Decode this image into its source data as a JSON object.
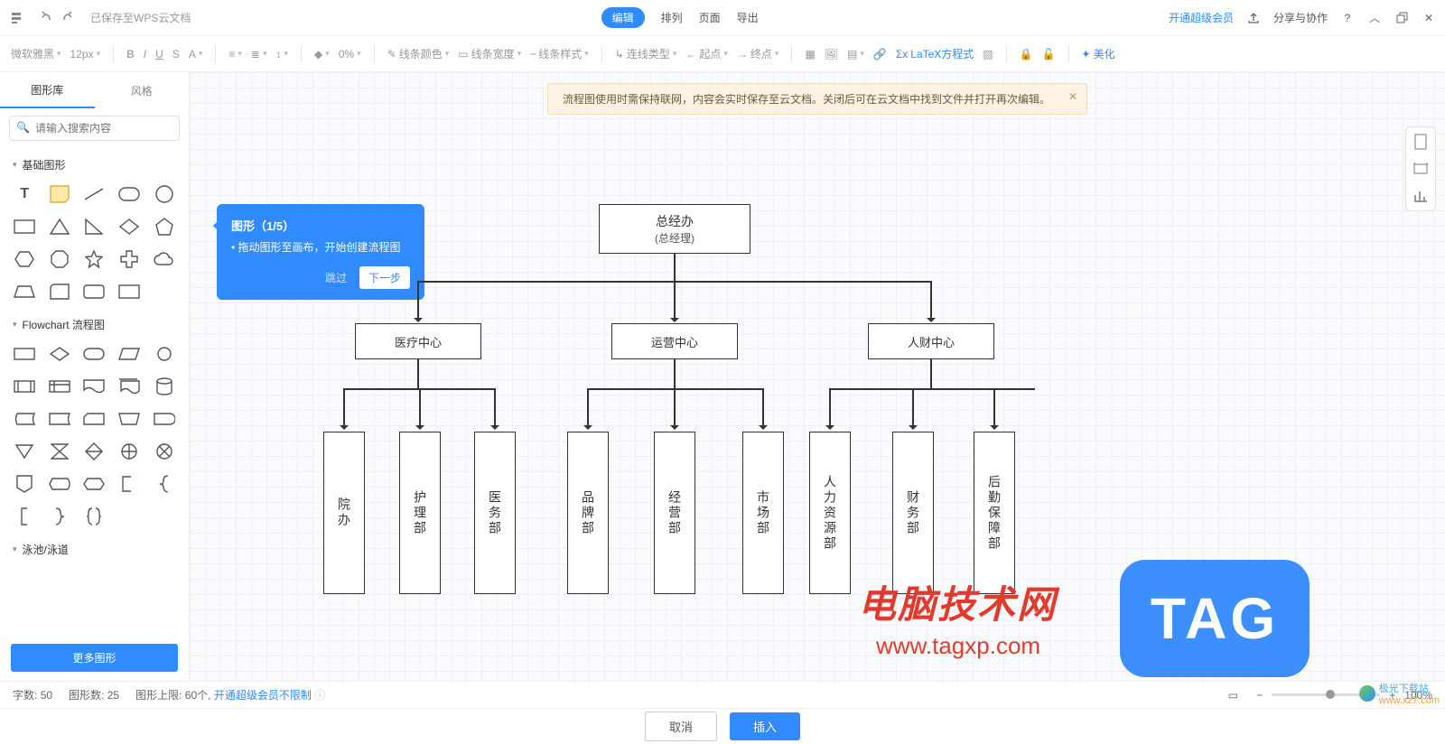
{
  "topbar": {
    "saved": "已保存至WPS云文档",
    "edit": "编辑",
    "arrange": "排列",
    "page": "页面",
    "export": "导出",
    "vip": "开通超级会员",
    "share": "分享与协作"
  },
  "toolbar": {
    "font": "微软雅黑",
    "size": "12px",
    "pct": "0%",
    "line_color": "线条颜色",
    "line_width": "线条宽度",
    "line_style": "线条样式",
    "conn_type": "连线类型",
    "start": "起点",
    "end": "终点",
    "latex": "LaTeX方程式",
    "beauty": "美化"
  },
  "sidebar": {
    "tab_lib": "图形库",
    "tab_style": "风格",
    "search_ph": "请输入搜索内容",
    "sec_basic": "基础图形",
    "sec_flow": "Flowchart 流程图",
    "sec_pool": "泳池/泳道",
    "more": "更多图形"
  },
  "notice": {
    "text": "流程图使用时需保持联网，内容会实时保存至云文档。关闭后可在云文档中找到文件并打开再次编辑。"
  },
  "tip": {
    "title": "图形（1/5）",
    "body": "拖动图形至画布，开始创建流程图",
    "skip": "跳过",
    "next": "下一步"
  },
  "chart_data": {
    "type": "org-tree",
    "root": {
      "title": "总经办",
      "subtitle": "(总经理)"
    },
    "level2": [
      {
        "label": "医疗中心"
      },
      {
        "label": "运营中心"
      },
      {
        "label": "人财中心"
      }
    ],
    "level3": [
      {
        "parent": 0,
        "label": "院办"
      },
      {
        "parent": 0,
        "label": "护理部"
      },
      {
        "parent": 0,
        "label": "医务部"
      },
      {
        "parent": 1,
        "label": "品牌部"
      },
      {
        "parent": 1,
        "label": "经营部"
      },
      {
        "parent": 1,
        "label": "市场部"
      },
      {
        "parent": 2,
        "label": "人力资源部"
      },
      {
        "parent": 2,
        "label": "财务部"
      },
      {
        "parent": 2,
        "label": "后勤保障部"
      }
    ]
  },
  "status": {
    "words_l": "字数:",
    "words_v": "50",
    "shapes_l": "图形数:",
    "shapes_v": "25",
    "limit_l": "图形上限:",
    "limit_v": "60个,",
    "unlimited": "开通超级会员不限制",
    "zoom": "100%"
  },
  "actions": {
    "cancel": "取消",
    "insert": "插入"
  },
  "wm": {
    "t1": "电脑技术网",
    "t2": "www.tagxp.com",
    "tag": "TAG",
    "dl": "极光下载站",
    "dlurl": "www.xz7.com"
  }
}
